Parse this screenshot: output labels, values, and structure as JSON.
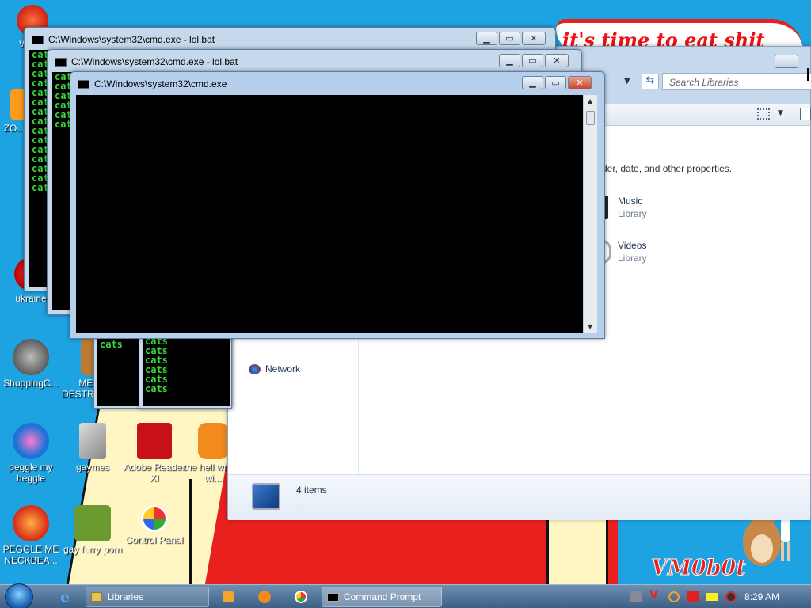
{
  "colors": {
    "desktop": "#1ea3e2",
    "cmd_text": "#39d639",
    "banner_text": "#e11111",
    "close_button": "#c8442b"
  },
  "banner": {
    "text": "it's time to eat shit"
  },
  "watermark": {
    "text": "VM0b0t"
  },
  "desktop_icons": [
    {
      "name": "WIN...",
      "icon": "peggle-icon"
    },
    {
      "name": "ZO... DE...",
      "icon": "folder-icon"
    },
    {
      "name": "ukraine",
      "icon": "ukraine-icon"
    },
    {
      "name": "ShoppingC...",
      "icon": "flash-icon"
    },
    {
      "name": "MEMZ DESTRUCTI...",
      "icon": "memz-icon"
    },
    {
      "name": "peggle my heggle",
      "icon": "peggle-icon"
    },
    {
      "name": "gaymes",
      "icon": "games-icon"
    },
    {
      "name": "Adobe Reader XI",
      "icon": "adobe-reader-icon"
    },
    {
      "name": "the hell wrong wi...",
      "icon": "uc-browser-icon"
    },
    {
      "name": "PEGGLE ME NECKBEA...",
      "icon": "peggle-icon"
    },
    {
      "name": "gay furry porn",
      "icon": "box-icon"
    },
    {
      "name": "Control Panel",
      "icon": "control-panel-icon"
    }
  ],
  "cmd_windows": [
    {
      "title": "C:\\Windows\\system32\\cmd.exe - lol.bat",
      "lines": [
        "cats",
        "cats",
        "cats",
        "cats",
        "cats",
        "cats",
        "cats",
        "cats",
        "cats",
        "cats",
        "cats",
        "cats",
        "cats",
        "cats",
        "cats"
      ]
    },
    {
      "title": "C:\\Windows\\system32\\cmd.exe - lol.bat",
      "lines": [
        "cats",
        "cats",
        "cats",
        "cats",
        "cats",
        "cats"
      ]
    },
    {
      "title": "C:\\Windows\\system32\\cmd.exe",
      "lines": []
    }
  ],
  "back_cmd": {
    "lines": [
      "cats",
      "cats",
      "cats",
      "cats",
      "cats",
      "cats"
    ],
    "partial": "cats"
  },
  "explorer": {
    "search_placeholder": "Search Libraries",
    "hint": "der, date, and other properties.",
    "libraries": [
      {
        "name": "Music",
        "type": "Library"
      },
      {
        "name": "Videos",
        "type": "Library"
      }
    ],
    "nav_network": "Network",
    "status": "4 items"
  },
  "taskbar": {
    "buttons": [
      {
        "label": "Libraries",
        "icon": "folder-icon"
      },
      {
        "label": "Command Prompt",
        "icon": "cmd-icon"
      }
    ],
    "pinned": [
      "internet-explorer-icon",
      "media-player-icon",
      "uc-browser-icon",
      "chrome-icon"
    ],
    "clock": "8:29 AM"
  }
}
